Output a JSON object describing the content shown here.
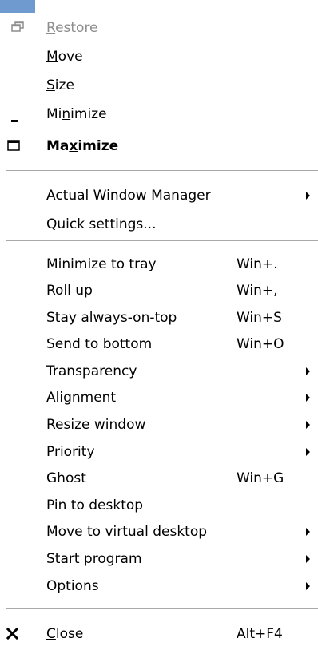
{
  "menu": {
    "restore": {
      "pre": "",
      "key": "R",
      "post": "estore",
      "icon": "restore-icon",
      "disabled": true
    },
    "move": {
      "pre": "",
      "key": "M",
      "post": "ove"
    },
    "size": {
      "pre": "",
      "key": "S",
      "post": "ize"
    },
    "minimize": {
      "pre": "Mi",
      "key": "n",
      "post": "imize",
      "icon": "minimize-icon"
    },
    "maximize": {
      "pre": "Ma",
      "key": "x",
      "post": "imize",
      "icon": "maximize-icon"
    },
    "actual_window_manager": {
      "label": "Actual Window Manager"
    },
    "quick_settings": {
      "label": "Quick settings..."
    },
    "minimize_to_tray": {
      "label": "Minimize to tray",
      "shortcut": "Win+."
    },
    "roll_up": {
      "label": "Roll up",
      "shortcut": "Win+,"
    },
    "stay_on_top": {
      "label": "Stay always-on-top",
      "shortcut": "Win+S"
    },
    "send_to_bottom": {
      "label": "Send to bottom",
      "shortcut": "Win+O"
    },
    "transparency": {
      "label": "Transparency"
    },
    "alignment": {
      "label": "Alignment"
    },
    "resize_window": {
      "label": "Resize window"
    },
    "priority": {
      "label": "Priority"
    },
    "ghost": {
      "label": "Ghost",
      "shortcut": "Win+G"
    },
    "pin_to_desktop": {
      "label": "Pin to desktop"
    },
    "move_to_virtual_desktop": {
      "label": "Move to virtual desktop"
    },
    "start_program": {
      "label": "Start program"
    },
    "options": {
      "label": "Options"
    },
    "close": {
      "pre": "",
      "key": "C",
      "post": "lose",
      "shortcut": "Alt+F4",
      "icon": "close-icon"
    }
  },
  "colors": {
    "accent": "#6f9ad0",
    "disabled_text": "#8d8d8d",
    "separator": "#a8a8a8",
    "background": "#ffffff"
  }
}
